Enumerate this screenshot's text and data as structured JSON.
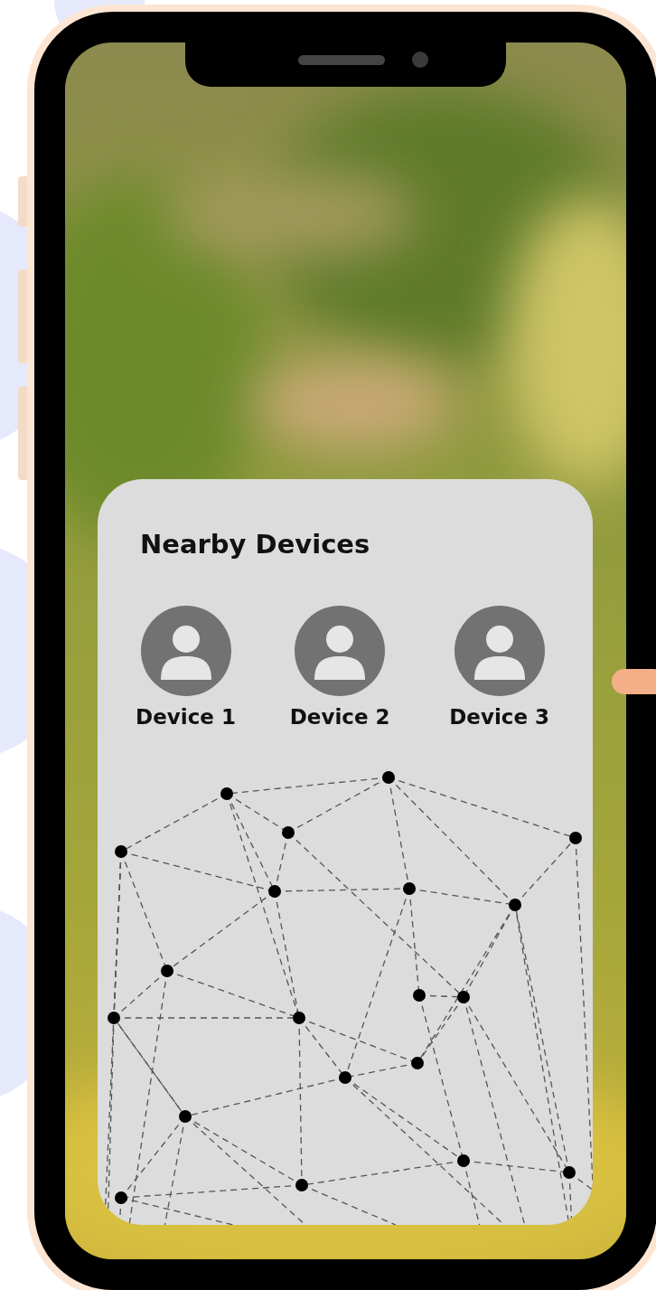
{
  "card": {
    "title": "Nearby Devices",
    "devices": [
      {
        "label": "Device 1"
      },
      {
        "label": "Device 2"
      },
      {
        "label": "Device 3"
      }
    ]
  }
}
